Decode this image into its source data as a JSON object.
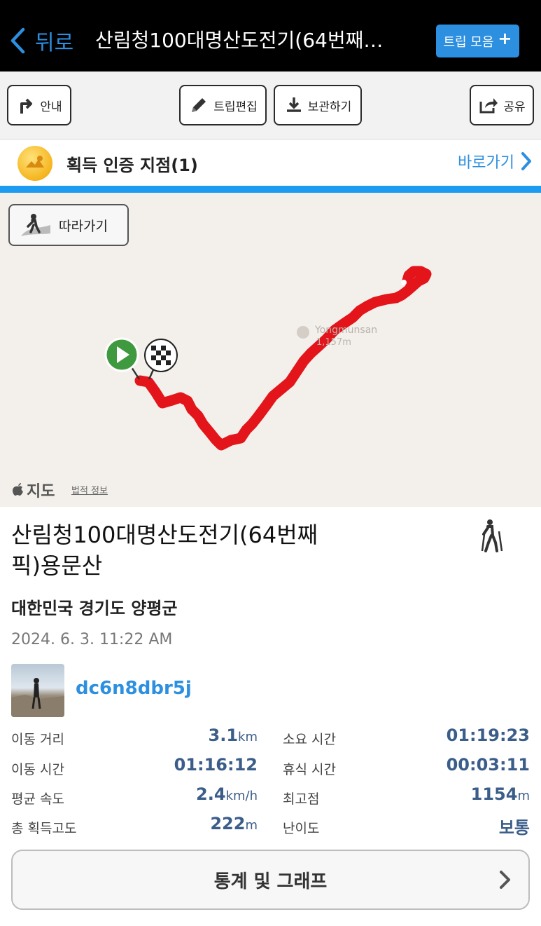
{
  "header": {
    "back_label": "뒤로",
    "title": "산림청100대명산도전기(64번째…",
    "trip_collection_label": "트립 모음"
  },
  "toolbar": {
    "guide_label": "안내",
    "edit_label": "트립편집",
    "save_label": "보관하기",
    "share_label": "공유"
  },
  "certification": {
    "title": "획득 인증 지점(1)",
    "link_label": "바로가기"
  },
  "map": {
    "follow_label": "따라가기",
    "poi_name": "Yongmunsan",
    "poi_elevation": "1,157m",
    "maps_brand": "지도",
    "legal_label": "법적 정보",
    "route_color": "#e3141a"
  },
  "trip": {
    "title": "산림청100대명산도전기(64번째픽)용문산",
    "region": "대한민국 경기도 양평군",
    "date": "2024. 6. 3. 11:22 AM",
    "username": "dc6n8dbr5j"
  },
  "stats": {
    "distance_label": "이동 거리",
    "distance_value": "3.1",
    "distance_unit": "km",
    "total_time_label": "소요 시간",
    "total_time_value": "01:19:23",
    "moving_time_label": "이동 시간",
    "moving_time_value": "01:16:12",
    "rest_time_label": "휴식 시간",
    "rest_time_value": "00:03:11",
    "avg_speed_label": "평균 속도",
    "avg_speed_value": "2.4",
    "avg_speed_unit": "km/h",
    "max_alt_label": "최고점",
    "max_alt_value": "1154",
    "max_alt_unit": "m",
    "elev_gain_label": "총 획득고도",
    "elev_gain_value": "222",
    "elev_gain_unit": "m",
    "difficulty_label": "난이도",
    "difficulty_value": "보통"
  },
  "graph_button_label": "통계 및 그래프",
  "colors": {
    "accent": "#2d8fe0",
    "value": "#3b5d8a",
    "progress_line": "#1d9bf0"
  }
}
